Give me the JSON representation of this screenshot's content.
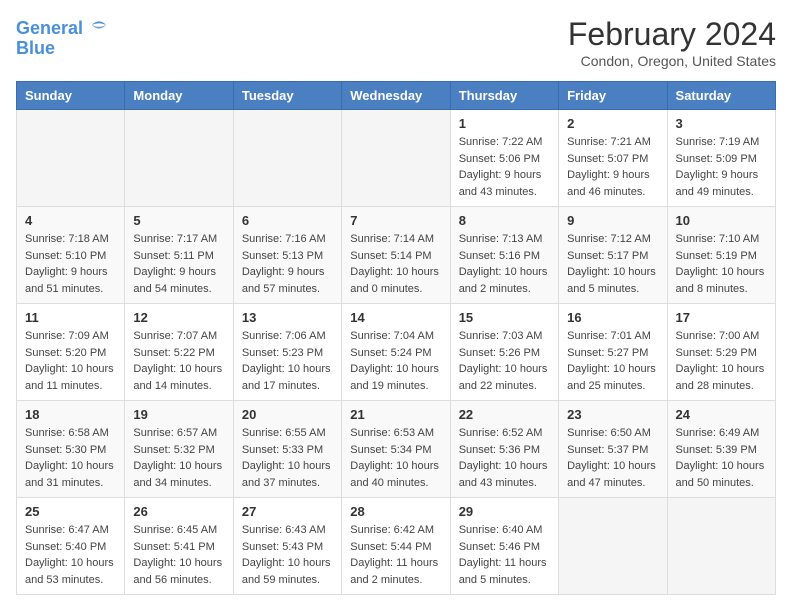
{
  "header": {
    "logo_line1": "General",
    "logo_line2": "Blue",
    "month": "February 2024",
    "location": "Condon, Oregon, United States"
  },
  "weekdays": [
    "Sunday",
    "Monday",
    "Tuesday",
    "Wednesday",
    "Thursday",
    "Friday",
    "Saturday"
  ],
  "weeks": [
    [
      {
        "day": "",
        "info": ""
      },
      {
        "day": "",
        "info": ""
      },
      {
        "day": "",
        "info": ""
      },
      {
        "day": "",
        "info": ""
      },
      {
        "day": "1",
        "info": "Sunrise: 7:22 AM\nSunset: 5:06 PM\nDaylight: 9 hours\nand 43 minutes."
      },
      {
        "day": "2",
        "info": "Sunrise: 7:21 AM\nSunset: 5:07 PM\nDaylight: 9 hours\nand 46 minutes."
      },
      {
        "day": "3",
        "info": "Sunrise: 7:19 AM\nSunset: 5:09 PM\nDaylight: 9 hours\nand 49 minutes."
      }
    ],
    [
      {
        "day": "4",
        "info": "Sunrise: 7:18 AM\nSunset: 5:10 PM\nDaylight: 9 hours\nand 51 minutes."
      },
      {
        "day": "5",
        "info": "Sunrise: 7:17 AM\nSunset: 5:11 PM\nDaylight: 9 hours\nand 54 minutes."
      },
      {
        "day": "6",
        "info": "Sunrise: 7:16 AM\nSunset: 5:13 PM\nDaylight: 9 hours\nand 57 minutes."
      },
      {
        "day": "7",
        "info": "Sunrise: 7:14 AM\nSunset: 5:14 PM\nDaylight: 10 hours\nand 0 minutes."
      },
      {
        "day": "8",
        "info": "Sunrise: 7:13 AM\nSunset: 5:16 PM\nDaylight: 10 hours\nand 2 minutes."
      },
      {
        "day": "9",
        "info": "Sunrise: 7:12 AM\nSunset: 5:17 PM\nDaylight: 10 hours\nand 5 minutes."
      },
      {
        "day": "10",
        "info": "Sunrise: 7:10 AM\nSunset: 5:19 PM\nDaylight: 10 hours\nand 8 minutes."
      }
    ],
    [
      {
        "day": "11",
        "info": "Sunrise: 7:09 AM\nSunset: 5:20 PM\nDaylight: 10 hours\nand 11 minutes."
      },
      {
        "day": "12",
        "info": "Sunrise: 7:07 AM\nSunset: 5:22 PM\nDaylight: 10 hours\nand 14 minutes."
      },
      {
        "day": "13",
        "info": "Sunrise: 7:06 AM\nSunset: 5:23 PM\nDaylight: 10 hours\nand 17 minutes."
      },
      {
        "day": "14",
        "info": "Sunrise: 7:04 AM\nSunset: 5:24 PM\nDaylight: 10 hours\nand 19 minutes."
      },
      {
        "day": "15",
        "info": "Sunrise: 7:03 AM\nSunset: 5:26 PM\nDaylight: 10 hours\nand 22 minutes."
      },
      {
        "day": "16",
        "info": "Sunrise: 7:01 AM\nSunset: 5:27 PM\nDaylight: 10 hours\nand 25 minutes."
      },
      {
        "day": "17",
        "info": "Sunrise: 7:00 AM\nSunset: 5:29 PM\nDaylight: 10 hours\nand 28 minutes."
      }
    ],
    [
      {
        "day": "18",
        "info": "Sunrise: 6:58 AM\nSunset: 5:30 PM\nDaylight: 10 hours\nand 31 minutes."
      },
      {
        "day": "19",
        "info": "Sunrise: 6:57 AM\nSunset: 5:32 PM\nDaylight: 10 hours\nand 34 minutes."
      },
      {
        "day": "20",
        "info": "Sunrise: 6:55 AM\nSunset: 5:33 PM\nDaylight: 10 hours\nand 37 minutes."
      },
      {
        "day": "21",
        "info": "Sunrise: 6:53 AM\nSunset: 5:34 PM\nDaylight: 10 hours\nand 40 minutes."
      },
      {
        "day": "22",
        "info": "Sunrise: 6:52 AM\nSunset: 5:36 PM\nDaylight: 10 hours\nand 43 minutes."
      },
      {
        "day": "23",
        "info": "Sunrise: 6:50 AM\nSunset: 5:37 PM\nDaylight: 10 hours\nand 47 minutes."
      },
      {
        "day": "24",
        "info": "Sunrise: 6:49 AM\nSunset: 5:39 PM\nDaylight: 10 hours\nand 50 minutes."
      }
    ],
    [
      {
        "day": "25",
        "info": "Sunrise: 6:47 AM\nSunset: 5:40 PM\nDaylight: 10 hours\nand 53 minutes."
      },
      {
        "day": "26",
        "info": "Sunrise: 6:45 AM\nSunset: 5:41 PM\nDaylight: 10 hours\nand 56 minutes."
      },
      {
        "day": "27",
        "info": "Sunrise: 6:43 AM\nSunset: 5:43 PM\nDaylight: 10 hours\nand 59 minutes."
      },
      {
        "day": "28",
        "info": "Sunrise: 6:42 AM\nSunset: 5:44 PM\nDaylight: 11 hours\nand 2 minutes."
      },
      {
        "day": "29",
        "info": "Sunrise: 6:40 AM\nSunset: 5:46 PM\nDaylight: 11 hours\nand 5 minutes."
      },
      {
        "day": "",
        "info": ""
      },
      {
        "day": "",
        "info": ""
      }
    ]
  ]
}
